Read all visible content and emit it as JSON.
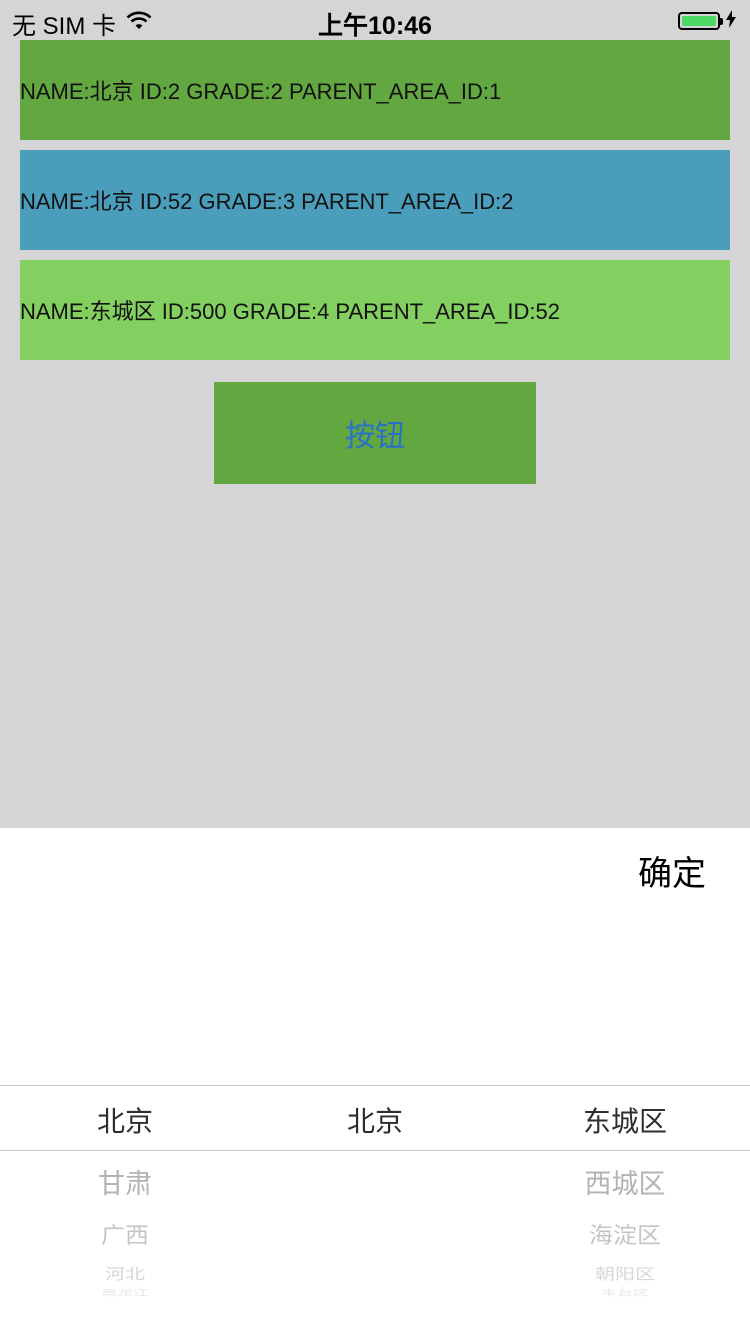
{
  "status_bar": {
    "carrier": "无 SIM 卡",
    "time": "上午10:46",
    "battery_color": "#4cd964"
  },
  "rows": [
    {
      "text": "NAME:北京 ID:2 GRADE:2 PARENT_AREA_ID:1",
      "color": "#63a740"
    },
    {
      "text": "NAME:北京 ID:52 GRADE:3 PARENT_AREA_ID:2",
      "color": "#4a9ebc"
    },
    {
      "text": "NAME:东城区 ID:500 GRADE:4 PARENT_AREA_ID:52",
      "color": "#83cf60"
    }
  ],
  "button": {
    "label": "按钮",
    "text_color": "#2a71c8"
  },
  "picker": {
    "confirm_label": "确定",
    "columns": [
      {
        "selected": "北京",
        "below": [
          "甘肃",
          "广西",
          "河北",
          "黑龙江"
        ]
      },
      {
        "selected": "北京",
        "below": []
      },
      {
        "selected": "东城区",
        "below": [
          "西城区",
          "海淀区",
          "朝阳区",
          "丰台区"
        ]
      }
    ]
  },
  "icons": [
    "wifi-icon",
    "battery-icon",
    "charging-icon"
  ]
}
